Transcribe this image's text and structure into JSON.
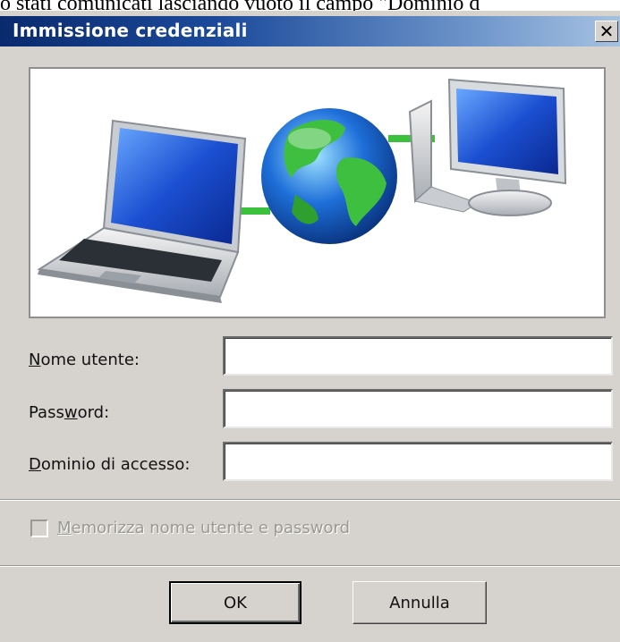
{
  "background_text": "o stati comunicati lasciando vuoto il campo \"Dominio d",
  "dialog": {
    "title": "Immissione credenziali",
    "close_glyph": "✕",
    "illustration": {
      "icons": [
        "laptop-icon",
        "globe-icon",
        "desktop-computer-icon",
        "network-link-icon"
      ],
      "colors": {
        "link": "#3cc13c",
        "screen": "#1b4fd1",
        "ocean": "#1e6fd9",
        "land": "#3fbf3f"
      }
    },
    "fields": [
      {
        "label_prefix": "",
        "label_mnemonic": "N",
        "label_suffix": "ome utente:",
        "value": "",
        "placeholder": ""
      },
      {
        "label_prefix": "Pass",
        "label_mnemonic": "w",
        "label_suffix": "ord:",
        "value": "",
        "placeholder": ""
      },
      {
        "label_prefix": "",
        "label_mnemonic": "D",
        "label_suffix": "ominio di accesso:",
        "value": "",
        "placeholder": ""
      }
    ],
    "remember": {
      "mnemonic": "M",
      "label_rest": "emorizza nome utente e password",
      "checked": false,
      "enabled": false
    },
    "buttons": {
      "ok": "OK",
      "cancel": "Annulla"
    },
    "colors": {
      "dialog_bg": "#d6d3ce",
      "title_start": "#0a2a6e",
      "title_end": "#a6c2e2"
    }
  }
}
